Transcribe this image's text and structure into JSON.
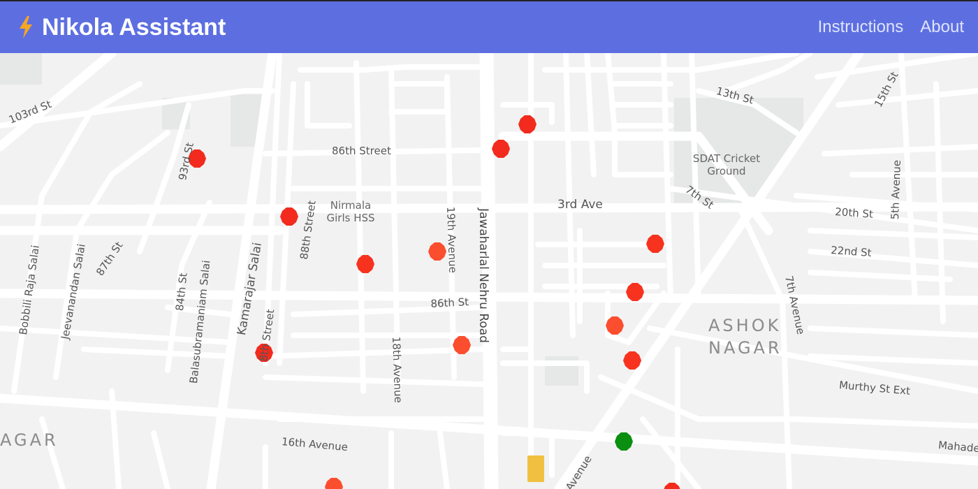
{
  "header": {
    "brand_icon": "lightning-bolt-icon",
    "title": "Nikola Assistant",
    "nav": {
      "instructions": "Instructions",
      "about": "About"
    },
    "colors": {
      "bar": "#5d6fe0",
      "accent": "#f5a623"
    }
  },
  "map": {
    "streets": {
      "s103rd": "103rd St",
      "s93rd": "93rd St",
      "s86thStreet": "86th Street",
      "s13th": "13th St",
      "s15th": "15th St",
      "s5thAve": "5th Avenue",
      "s7th": "7th St",
      "s20th": "20th St",
      "s22nd": "22nd St",
      "s3rdAve": "3rd Ave",
      "s88th": "88th Street",
      "s19thAve": "19th Avenue",
      "jnRoad": "Jawaharlal Nehru Road",
      "s86thSt": "86th St",
      "s7thAve": "7th Avenue",
      "bobbili": "Bobbili Raja Salai",
      "jeevanandan": "Jeevanandan Salai",
      "s87th": "87th St",
      "s84th": "84th St",
      "balasubramaniam": "Balasubramaniam Salai",
      "kamarajar": "Kamarajar Salai",
      "s8thStreet": "8th Street",
      "s18thAve": "18th Avenue",
      "murthy": "Murthy St Ext",
      "s16thAve": "16th Avenue",
      "mahadev": "Mahade",
      "avenue": "Avenue"
    },
    "areas": {
      "ashok_line1": "ASHOK",
      "ashok_line2": "NAGAR",
      "nagar_left": "AGAR"
    },
    "pois": {
      "cricket": "SDAT Cricket\nGround",
      "nirmala": "Nirmala\nGirls HSS"
    },
    "marker_colors": {
      "red": "#f22b1e",
      "orange": "#fb4e2f",
      "green": "#0a8f10",
      "yellow": "#f0c040"
    }
  }
}
